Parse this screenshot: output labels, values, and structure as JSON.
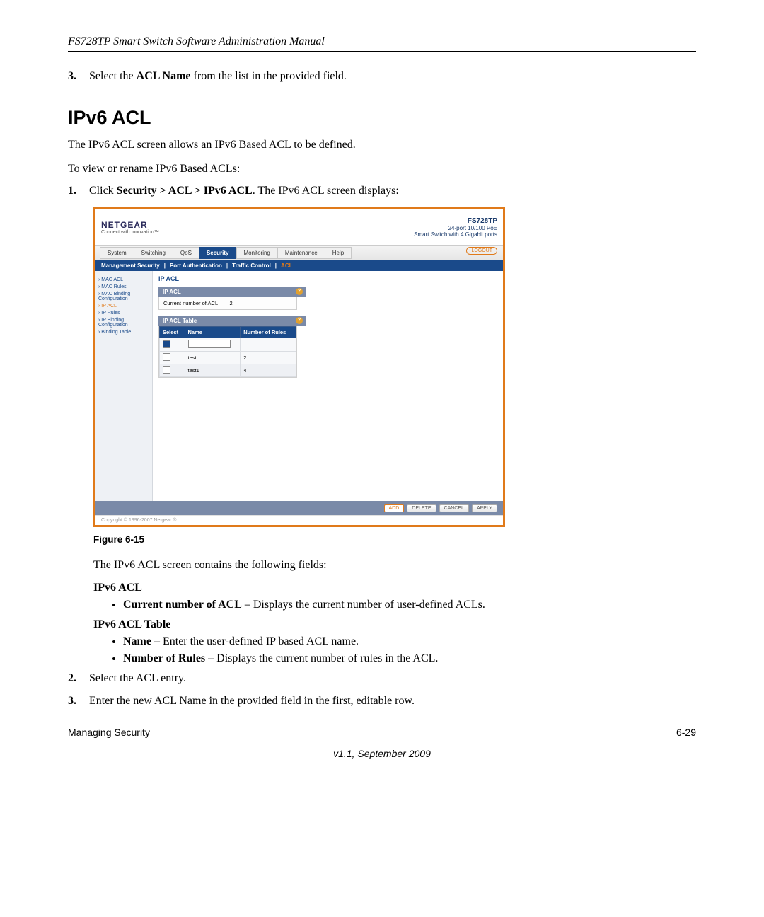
{
  "header": {
    "manual_title": "FS728TP Smart Switch Software Administration Manual"
  },
  "steps_top": {
    "num3": "3.",
    "text3_a": "Select the ",
    "text3_b": "ACL Name",
    "text3_c": " from the list in the provided field."
  },
  "section": {
    "title": "IPv6 ACL",
    "intro": "The IPv6 ACL screen allows an IPv6 Based ACL to be defined.",
    "toview": "To view or rename IPv6 Based ACLs:",
    "num1": "1.",
    "click_a": "Click ",
    "click_b": "Security > ACL > IPv6 ACL",
    "click_c": ". The IPv6 ACL screen displays:"
  },
  "screenshot": {
    "logo": "NETGEAR",
    "logo_sub": "Connect with Innovation™",
    "model": "FS728TP",
    "model_sub1": "24-port 10/100 PoE",
    "model_sub2": "Smart Switch with 4 Gigabit ports",
    "tabs": [
      "System",
      "Switching",
      "QoS",
      "Security",
      "Monitoring",
      "Maintenance",
      "Help"
    ],
    "active_tab": "Security",
    "logout": "LOGOUT",
    "subtabs": [
      "Management Security",
      "Port Authentication",
      "Traffic Control",
      "ACL"
    ],
    "active_subtab": "ACL",
    "sidebar": [
      "› MAC ACL",
      "› MAC Rules",
      "› MAC Binding Configuration",
      "› IP ACL",
      "› IP Rules",
      "› IP Binding Configuration",
      "› Binding Table"
    ],
    "sidebar_selected": "› IP ACL",
    "main_title": "IP ACL",
    "panel1_title": "IP ACL",
    "panel1_label": "Current number of ACL",
    "panel1_value": "2",
    "panel2_title": "IP ACL Table",
    "table_headers": [
      "Select",
      "Name",
      "Number of Rules"
    ],
    "table_rows": [
      {
        "select": "filled",
        "name_input": "",
        "rules": ""
      },
      {
        "select": "",
        "name": "test",
        "rules": "2"
      },
      {
        "select": "",
        "name": "test1",
        "rules": "4"
      }
    ],
    "buttons": [
      "ADD",
      "DELETE",
      "CANCEL",
      "APPLY"
    ],
    "copyright": "Copyright © 1996-2007 Netgear ®"
  },
  "figure_label": "Figure 6-15",
  "after_figure": {
    "contains": "The IPv6 ACL screen contains the following fields:",
    "h1": "IPv6 ACL",
    "b1_a": "Current number of ACL",
    "b1_b": " – Displays the current number of user-defined ACLs.",
    "h2": "IPv6 ACL Table",
    "b2_a": "Name",
    "b2_b": " – Enter the user-defined IP based ACL name.",
    "b3_a": "Number of Rules",
    "b3_b": " – Displays the current number of rules in the ACL.",
    "num2": "2.",
    "text2": "Select the ACL entry.",
    "num3": "3.",
    "text3": "Enter the new ACL Name in the provided field in the first, editable row."
  },
  "footer": {
    "left": "Managing Security",
    "right": "6-29",
    "center": "v1.1, September 2009"
  }
}
